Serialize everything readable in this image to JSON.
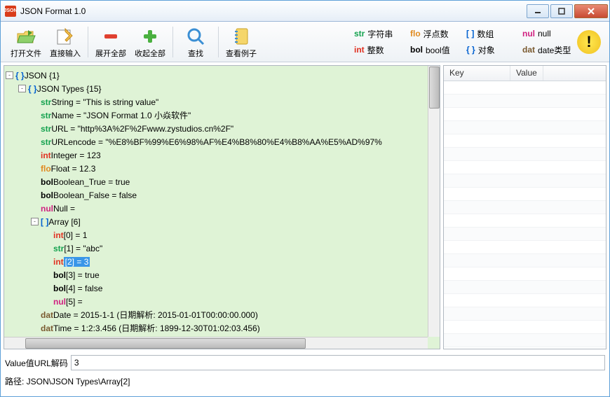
{
  "window": {
    "title": "JSON Format 1.0",
    "app_badge": "JSON"
  },
  "toolbar": {
    "open": "打开文件",
    "input": "直接输入",
    "expand": "展开全部",
    "collapse": "收起全部",
    "find": "查找",
    "example": "查看例子"
  },
  "legend": {
    "str": "字符串",
    "flo": "浮点数",
    "arr": "数组",
    "nul": "null",
    "int": "整数",
    "bol": "bool值",
    "obj": "对象",
    "dat": "date类型"
  },
  "tree": {
    "root": "JSON {1}",
    "types": "JSON Types {15}",
    "items": [
      {
        "tag": "str",
        "text": "String = \"This is string value\""
      },
      {
        "tag": "str",
        "text": "Name = \"JSON Format 1.0 小焱软件\""
      },
      {
        "tag": "str",
        "text": "URL = \"http%3A%2F%2Fwww.zystudios.cn%2F\""
      },
      {
        "tag": "str",
        "text": "URLencode = \"%E8%BF%99%E6%98%AF%E4%B8%80%E4%B8%AA%E5%AD%97%"
      },
      {
        "tag": "int",
        "text": "Integer = 123"
      },
      {
        "tag": "flo",
        "text": "Float = 12.3"
      },
      {
        "tag": "bol",
        "text": "Boolean_True = true"
      },
      {
        "tag": "bol",
        "text": "Boolean_False = false"
      },
      {
        "tag": "nul",
        "text": "Null ="
      }
    ],
    "array_label": "Array [6]",
    "array_items": [
      {
        "tag": "int",
        "text": "[0] = 1",
        "sel": false
      },
      {
        "tag": "str",
        "text": "[1] = \"abc\"",
        "sel": false
      },
      {
        "tag": "int",
        "text": "[2] = 3",
        "sel": true
      },
      {
        "tag": "bol",
        "text": "[3] = true",
        "sel": false
      },
      {
        "tag": "bol",
        "text": "[4] = false",
        "sel": false
      },
      {
        "tag": "nul",
        "text": "[5] =",
        "sel": false
      }
    ],
    "tail": [
      {
        "tag": "dat",
        "text": "Date = 2015-1-1 (日期解析: 2015-01-01T00:00:00.000)"
      },
      {
        "tag": "dat",
        "text": "Time = 1:2:3.456 (日期解析: 1899-12-30T01:02:03.456)"
      }
    ]
  },
  "kv": {
    "key_header": "Key",
    "value_header": "Value"
  },
  "decode": {
    "label": "Value值URL解码",
    "value": "3"
  },
  "status": {
    "path": "路径: JSON\\JSON Types\\Array[2]"
  }
}
